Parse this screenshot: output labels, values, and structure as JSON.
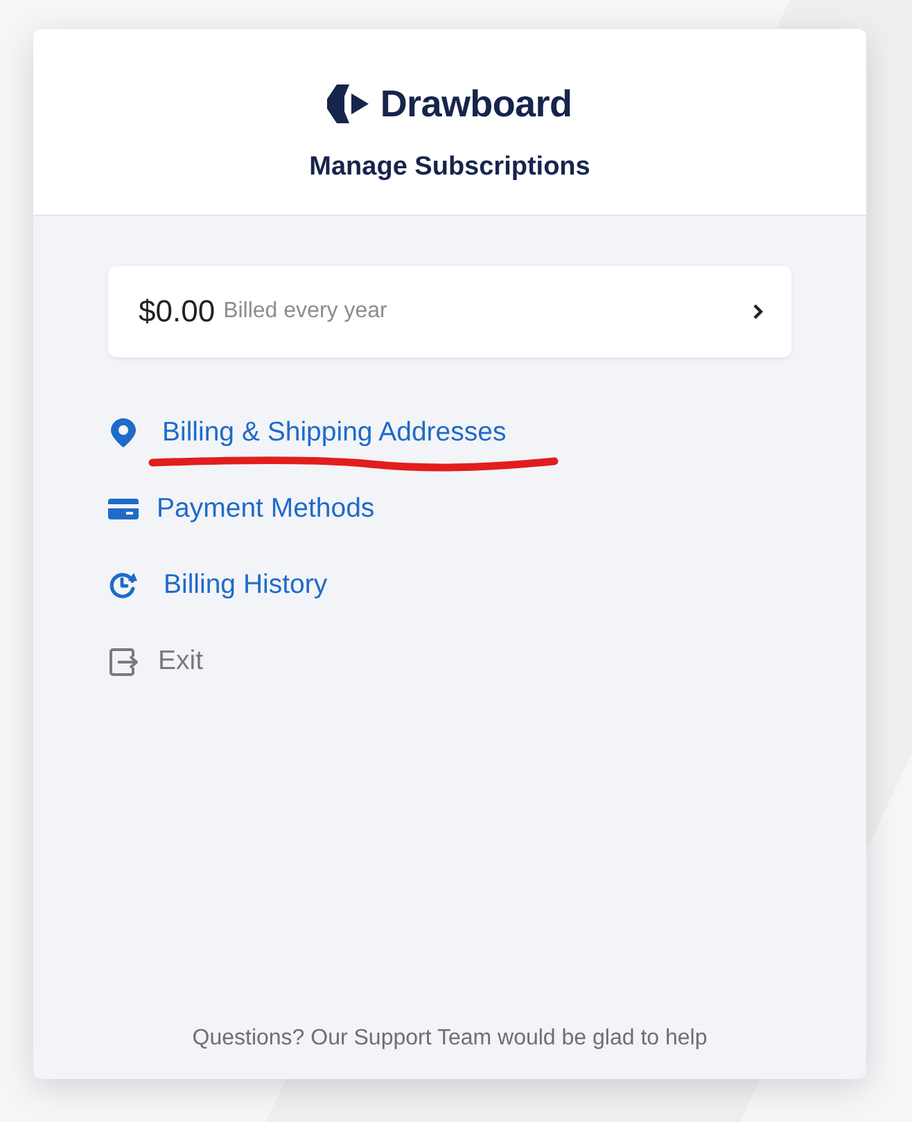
{
  "brand": {
    "name": "Drawboard"
  },
  "title": "Manage Subscriptions",
  "plan": {
    "price": "$0.00",
    "period": "Billed every year"
  },
  "menu": [
    {
      "kind": "link",
      "label": "Billing & Shipping Addresses",
      "annotated": true
    },
    {
      "kind": "link",
      "label": "Payment Methods",
      "annotated": false
    },
    {
      "kind": "link",
      "label": "Billing History",
      "annotated": false
    },
    {
      "kind": "exit",
      "label": "Exit",
      "annotated": false
    }
  ],
  "footer": "Questions? Our Support Team would be glad to help"
}
